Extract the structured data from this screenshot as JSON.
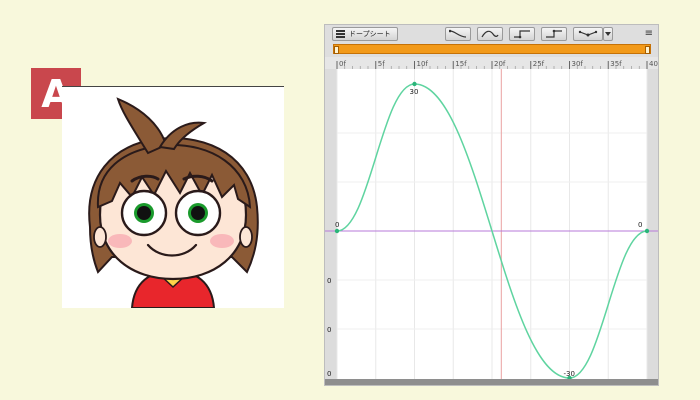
{
  "badge": {
    "label": "A",
    "color": "#c9474d"
  },
  "toolbar": {
    "dopesheet_label": "ドープシート",
    "icons": [
      "dopesheet-icon",
      "ease-out-icon",
      "ease-in-out-icon",
      "step-key-icon",
      "hold-key-icon",
      "bezier-handles-icon",
      "dropdown-arrow-icon",
      "panel-menu-icon"
    ],
    "menu_glyph": "≡"
  },
  "range_bar": {
    "color": "#f29a1a"
  },
  "ruler": {
    "ticks": [
      "0f",
      "5f",
      "10f",
      "15f",
      "20f",
      "25f",
      "30f",
      "35f",
      "40"
    ]
  },
  "value_labels": {
    "left": [
      "0",
      "0",
      "0",
      "0"
    ],
    "start_key": "0",
    "peak_key": "30",
    "trough_key": "-30",
    "end_key": "0"
  },
  "chart_data": {
    "type": "line",
    "title": "",
    "xlabel": "",
    "ylabel": "",
    "series": [
      {
        "values_frames": [
          0,
          10,
          30,
          40
        ],
        "values": [
          0,
          30,
          -30,
          0
        ]
      }
    ],
    "xlim": [
      0,
      40
    ],
    "ylim": [
      -30,
      30
    ],
    "curve_color": "#5fd4a0",
    "zero_line_color": "#b77ad8",
    "grid": true
  }
}
